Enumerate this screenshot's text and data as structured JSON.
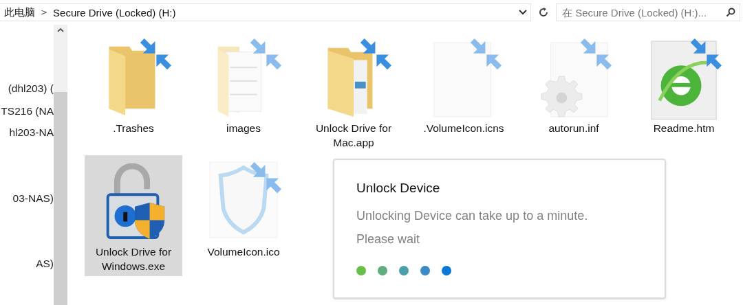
{
  "address_bar": {
    "breadcrumbs": [
      "此电脑",
      "Secure Drive (Locked) (H:)"
    ],
    "separator": ">"
  },
  "search": {
    "placeholder": "在 Secure Drive (Locked) (H:)..."
  },
  "sidebar": {
    "items": [
      "(dhl203) (",
      "TS216 (NA",
      "hl203-NA",
      "03-NAS)",
      "AS)"
    ]
  },
  "files": [
    {
      "name": ".Trashes",
      "kind": "folder",
      "shortcut": true,
      "hidden": false,
      "selected": false
    },
    {
      "name": "images",
      "kind": "image-folder",
      "shortcut": true,
      "hidden": true,
      "selected": false
    },
    {
      "name": "Unlock Drive for Mac.app",
      "kind": "app-folder",
      "shortcut": true,
      "hidden": false,
      "selected": false
    },
    {
      "name": ".VolumeIcon.icns",
      "kind": "blank-file",
      "shortcut": true,
      "hidden": true,
      "selected": false
    },
    {
      "name": "autorun.inf",
      "kind": "settings-file",
      "shortcut": true,
      "hidden": true,
      "selected": false
    },
    {
      "name": "Readme.htm",
      "kind": "web-file",
      "shortcut": true,
      "hidden": false,
      "selected": false
    },
    {
      "name": "Unlock Drive for Windows.exe",
      "kind": "lock-app",
      "shortcut": false,
      "hidden": false,
      "selected": true
    },
    {
      "name": "VolumeIcon.ico",
      "kind": "shield-file",
      "shortcut": true,
      "hidden": true,
      "selected": false
    }
  ],
  "dialog": {
    "title": "Unlock Device",
    "message": "Unlocking Device can take up to a minute.",
    "status": "Please wait",
    "dots": [
      {
        "color": "#6abf4b"
      },
      {
        "color": "#5fae80"
      },
      {
        "color": "#4a9fa8"
      },
      {
        "color": "#3a8cc4"
      },
      {
        "color": "#0a78d7"
      }
    ]
  }
}
